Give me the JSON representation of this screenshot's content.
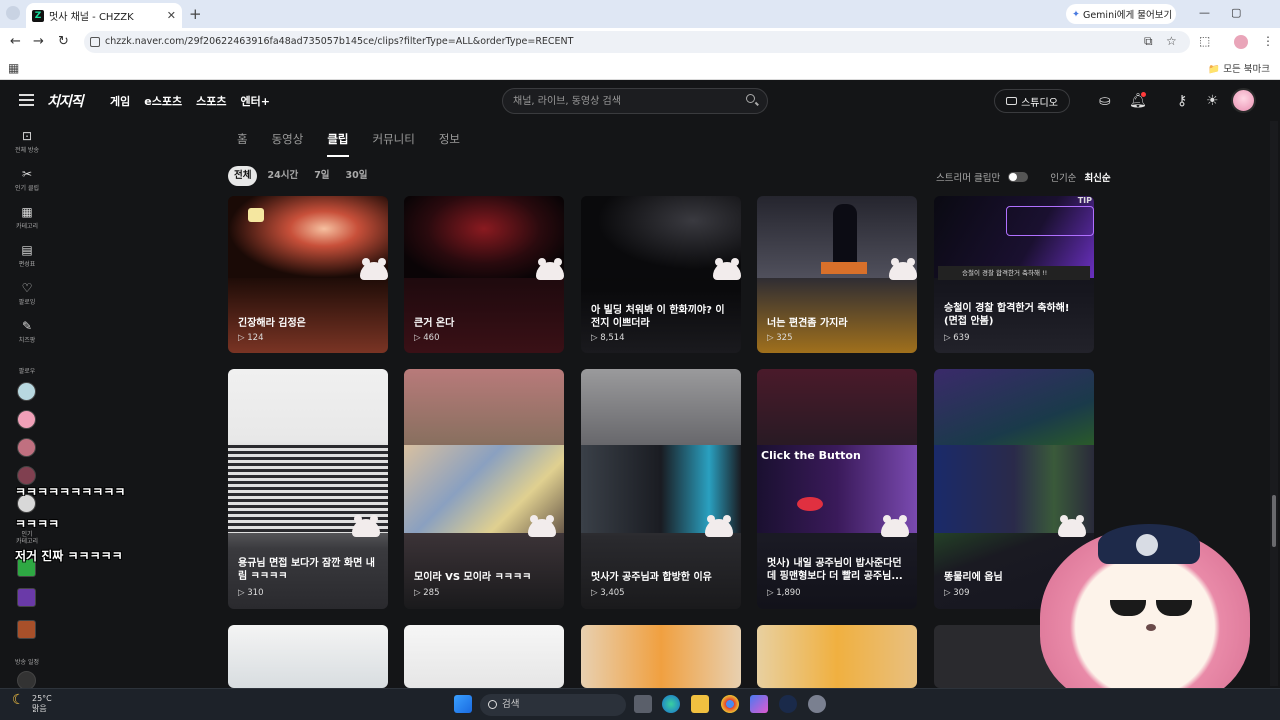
{
  "browser": {
    "tab_title": "멋사 채널 - CHZZK",
    "tab_favicon": "Z",
    "gemini_button": "Gemini에게 물어보기",
    "url": "chzzk.naver.com/29f20622463916fa48ad735057b145ce/clips?filterType=ALL&orderType=RECENT",
    "all_bookmarks": "모든 북마크"
  },
  "header": {
    "logo": "치지직",
    "nav": [
      "게임",
      "e스포츠",
      "스포츠",
      "엔터+"
    ],
    "search_placeholder": "채널, 라이브, 동영상 검색",
    "studio_label": "스튜디오"
  },
  "sidebar": {
    "items": [
      {
        "label": "전체 방송",
        "icon": "live-icon"
      },
      {
        "label": "인기 클립",
        "icon": "clip-icon"
      },
      {
        "label": "카테고리",
        "icon": "category-icon"
      },
      {
        "label": "편성표",
        "icon": "calendar-icon"
      },
      {
        "label": "팔로잉",
        "icon": "heart-icon"
      },
      {
        "label": "치즈팡",
        "icon": "pen-icon"
      }
    ],
    "following_title": "팔로우",
    "popular_label": "인기\n카테고리",
    "broadcast_title": "방송 일정"
  },
  "channel_tabs": [
    "홈",
    "동영상",
    "클립",
    "커뮤니티",
    "정보"
  ],
  "active_tab": "클립",
  "filters": {
    "period": [
      "전체",
      "24시간",
      "7일",
      "30일"
    ],
    "active_period": "전체",
    "streamer_only": "스트리머 클립만",
    "sort": [
      "인기순",
      "최신순"
    ],
    "active_sort": "최신순"
  },
  "clips_row1": [
    {
      "title": "긴장해라 김정은",
      "views": "124"
    },
    {
      "title": "큰거 온다",
      "views": "460"
    },
    {
      "title": "아 빌딩 처워봐 이 한화끼야? 이 전지 이쁘더라",
      "views": "8,514"
    },
    {
      "title": "너는 편견좀 가지라",
      "views": "325"
    },
    {
      "title": "승철이 경찰 합격한거 축하해! (면접 안봄)",
      "views": "639"
    }
  ],
  "clips_row2": [
    {
      "title": "용규님 면접 보다가 잠깐 화면 내림 ㅋㅋㅋㅋ",
      "views": "310"
    },
    {
      "title": "모이라 VS 모이라 ㅋㅋㅋㅋ",
      "views": "285"
    },
    {
      "title": "멋사가 공주님과 합방한 이유",
      "views": "3,405"
    },
    {
      "title": "멋사) 내일 공주님이 밥사준다던데 핑맨형보다 더 빨리 공주님...",
      "views": "1,890"
    },
    {
      "title": "똥물리에 옵님",
      "views": "309"
    }
  ],
  "card5_overlay_text": "승철이 경찰 합격한거 축하해 !!",
  "card5_badge": "TIP",
  "card4_button_text": "Click the Button",
  "chat_overlay": [
    "ㅋㅋㅋㅋㅋㅋㅋㅋㅋㅋ",
    "ㅋㅋㅋㅋ",
    "저거 진짜 ㅋㅋㅋㅋㅋ"
  ],
  "taskbar": {
    "temperature": "25°C",
    "weather": "맑음",
    "search_placeholder": "검색"
  }
}
